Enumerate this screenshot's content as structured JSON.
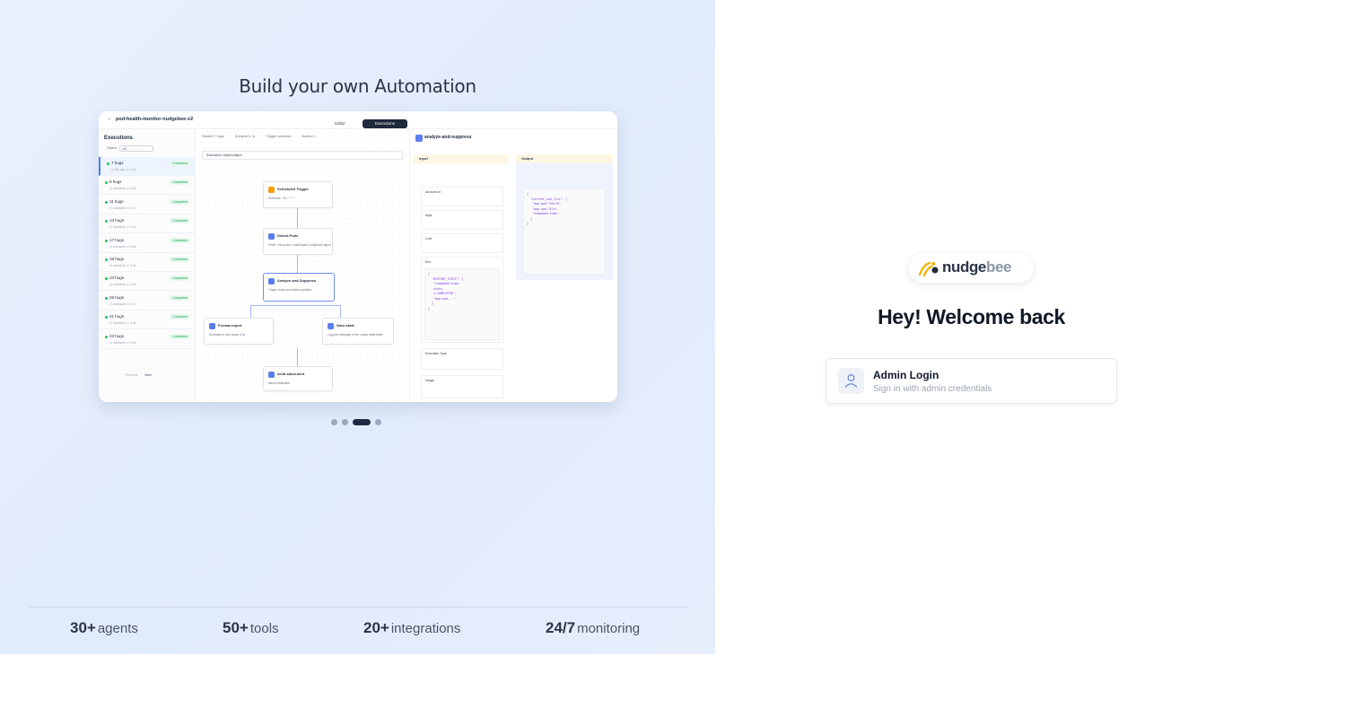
{
  "hero": {
    "title": "Build your own Automation",
    "preview": {
      "workflow_name": "pod-health-monitor-nudgebee-v2",
      "tabs": [
        "Editor",
        "Executions"
      ],
      "executions_title": "Executions",
      "filter_label": "Status",
      "filter_value": "All",
      "rows": [
        {
          "title": "7 hugs",
          "sub": "◴ 8m ago  ◴ 4.1s",
          "badge": "Completed"
        },
        {
          "title": "9 hugs",
          "sub": "◴ schedule  ◴ 5.2s",
          "badge": "Completed"
        },
        {
          "title": "11 hugs",
          "sub": "◴ schedule  ◴ 3.7s",
          "badge": "Completed"
        },
        {
          "title": "13 hugs",
          "sub": "◴ schedule  ◴ 4.1s",
          "badge": "Completed"
        },
        {
          "title": "17 hugs",
          "sub": "◴ schedule  ◴ 5.8s",
          "badge": "Completed"
        },
        {
          "title": "19 hugs",
          "sub": "◴ schedule  ◴ 3.3s",
          "badge": "Completed"
        },
        {
          "title": "23 hugs",
          "sub": "◴ schedule  ◴ 4.4s",
          "badge": "Completed"
        },
        {
          "title": "29 hugs",
          "sub": "◴ schedule  ◴ 3.7s",
          "badge": "Completed"
        },
        {
          "title": "41 hugs",
          "sub": "◴ schedule  ◴ 3.3s",
          "badge": "Completed"
        },
        {
          "title": "43 hugs",
          "sub": "◴ schedule  ◴ 4.5s",
          "badge": "Completed"
        }
      ],
      "pager_prev": "Previous",
      "pager_next": "Next",
      "meta": [
        "Started  7 hugs",
        "Duration  6.7s",
        "Trigger  schedule",
        "Nodes  5"
      ],
      "exec_select": "Execution input/output",
      "nodes": [
        {
          "title": "Scheduled Trigger",
          "desc": "Schedule: */5 * * * *"
        },
        {
          "title": "Detect-Pods",
          "desc": "Fetch: Get pods in namespace  nudgebee-agent"
        },
        {
          "title": "Analyze-and-Suppress",
          "desc": "Triage recent pod status updates"
        },
        {
          "title": "Format-report",
          "desc": "Summarize root cause & fix"
        },
        {
          "title": "Save-state",
          "desc": "Log pod message in the output  state table"
        },
        {
          "title": "send-slack-alert",
          "desc": "slack notification"
        }
      ],
      "inspector_title": "analyze-and-suppress",
      "input_label": "Input",
      "output_label": "Output",
      "fields": [
        "Account Id",
        "Args",
        "Cost",
        "Env",
        "Execution Type",
        "Image"
      ],
      "code_input": "{\n  \"HISTORY_STATE\": {\n   \"nudgebee-kube-\n   state-\n   1:COMPLETED\",\n   \"app.pod-...\"\n  }\n}",
      "code_output": "{\n  \"current_pod_list\": [\n   \"app.pod-755c7b\",\n   \"app.pod-7f1d\",\n   \"nudgebee-kube\"\n  ]\n}"
    },
    "carousel_count": 4,
    "carousel_active": 2
  },
  "stats": [
    {
      "number": "30+",
      "label": "agents"
    },
    {
      "number": "50+",
      "label": "tools"
    },
    {
      "number": "20+",
      "label": "integrations"
    },
    {
      "number": "24/7",
      "label": "monitoring"
    }
  ],
  "brand": {
    "name_part1": "nudge",
    "name_part2": "bee",
    "icon": "bee-logo-icon"
  },
  "welcome": "Hey! Welcome back",
  "login_option": {
    "title": "Admin Login",
    "subtitle": "Sign in with admin credentials",
    "icon": "user-icon"
  }
}
